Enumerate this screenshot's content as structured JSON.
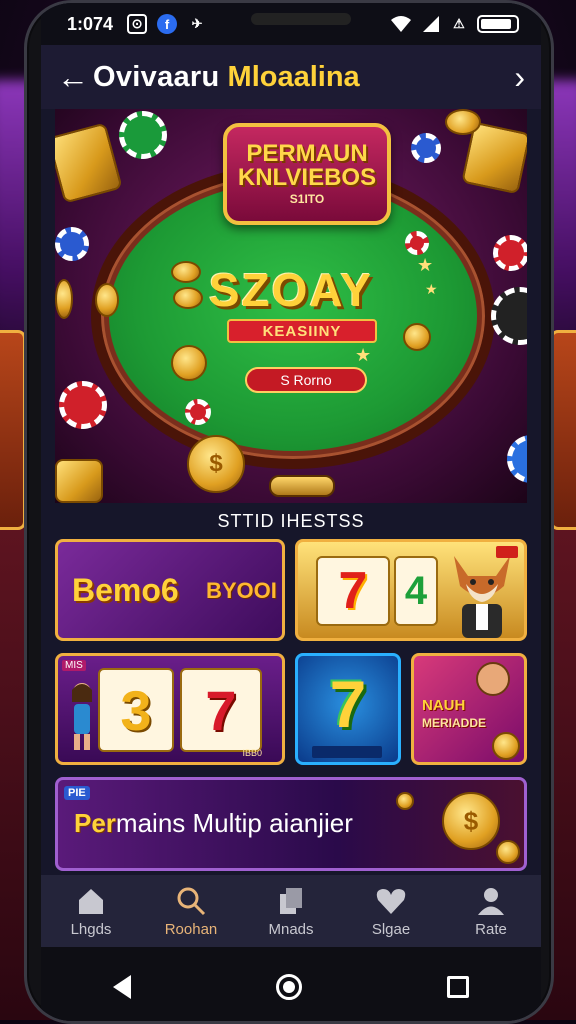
{
  "status": {
    "time": "1:0§4",
    "time_display": "1:074",
    "battery_color": "#ffffff"
  },
  "header": {
    "title": "Ovivaaru",
    "title_accent": "Mloaalina"
  },
  "hero": {
    "logo_line1": "PERMAUN",
    "logo_line2": "KNLVIEBOS",
    "logo_line3": "S1ITO",
    "big_text": "SZOAY",
    "ribbon": "KEASIINY",
    "button": "S Rorno"
  },
  "section": {
    "title": "STTID IHESTSS"
  },
  "tiles": {
    "t1_title": "Bemo6",
    "t1_sub": "BYOOI",
    "t2_reel1": "7",
    "t2_reel2": "4",
    "t3_reel1": "3",
    "t3_reel2": "7",
    "t3_badge": "MIS",
    "t3_footer_r": "IBB0",
    "t4_seven": "7",
    "t5_line1": "NAUH",
    "t5_line2": "MERIADDE",
    "t6_badge": "PIE",
    "t6_text_accent": "Per",
    "t6_text": "mains Multip aianjier"
  },
  "nav": {
    "items": [
      {
        "label": "Lhgds",
        "icon": "home-icon"
      },
      {
        "label": "Roohan",
        "icon": "search-icon"
      },
      {
        "label": "Mnads",
        "icon": "cards-icon"
      },
      {
        "label": "Slgae",
        "icon": "heart-icon"
      },
      {
        "label": "Rate",
        "icon": "profile-icon"
      }
    ]
  },
  "colors": {
    "accent_gold": "#ffd23a",
    "header_bg": "#1d1b33",
    "nav_bg": "#24243a",
    "active_nav": "#e8b478"
  }
}
